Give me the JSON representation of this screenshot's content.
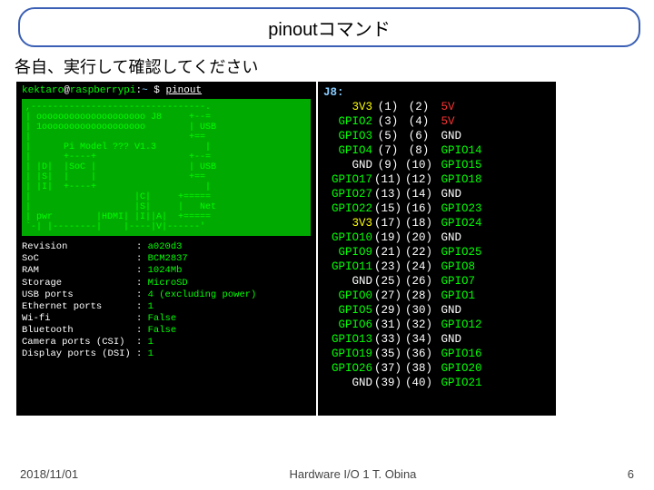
{
  "title": "pinoutコマンド",
  "subtitle": "各自、実行して確認してください",
  "prompt": {
    "user": "kektaro",
    "host": "raspberrypi",
    "path": "~",
    "cmd": "pinout"
  },
  "board_art": ",--------------------------------.\n| oooooooooooooooooooo J8     +--=\n| 1ooooooooooooooooooo        | USB\n|                             +==\n|      Pi Model ??? V1.3         |\n|      +----+                 +--=\n| |D|  |SoC |                 | USB\n| |S|  |    |                 +==\n| |I|  +----+                    |\n|                   |C|     +=====\n|                   |S|     |   Net\n| pwr        |HDMI| |I||A|  +=====\n`-| |--------|    |----|V|------'",
  "specs": [
    {
      "k": "Revision",
      "v": "a020d3"
    },
    {
      "k": "SoC",
      "v": "BCM2837"
    },
    {
      "k": "RAM",
      "v": "1024Mb"
    },
    {
      "k": "Storage",
      "v": "MicroSD"
    },
    {
      "k": "USB ports",
      "v": "4 (excluding power)"
    },
    {
      "k": "Ethernet ports",
      "v": "1"
    },
    {
      "k": "Wi-fi",
      "v": "False"
    },
    {
      "k": "Bluetooth",
      "v": "False"
    },
    {
      "k": "Camera ports (CSI)",
      "v": "1"
    },
    {
      "k": "Display ports (DSI)",
      "v": "1"
    }
  ],
  "j8_header": "J8:",
  "pins": [
    {
      "l": "3V3",
      "lcls": "c-yellow",
      "n1": "(1)",
      "n2": "(2)",
      "r": "5V",
      "rcls": "c-red"
    },
    {
      "l": "GPIO2",
      "lcls": "c-green",
      "n1": "(3)",
      "n2": "(4)",
      "r": "5V",
      "rcls": "c-red"
    },
    {
      "l": "GPIO3",
      "lcls": "c-green",
      "n1": "(5)",
      "n2": "(6)",
      "r": "GND",
      "rcls": "c-white"
    },
    {
      "l": "GPIO4",
      "lcls": "c-green",
      "n1": "(7)",
      "n2": "(8)",
      "r": "GPIO14",
      "rcls": "c-green"
    },
    {
      "l": "GND",
      "lcls": "c-white",
      "n1": "(9)",
      "n2": "(10)",
      "r": "GPIO15",
      "rcls": "c-green"
    },
    {
      "l": "GPIO17",
      "lcls": "c-green",
      "n1": "(11)",
      "n2": "(12)",
      "r": "GPIO18",
      "rcls": "c-green"
    },
    {
      "l": "GPIO27",
      "lcls": "c-green",
      "n1": "(13)",
      "n2": "(14)",
      "r": "GND",
      "rcls": "c-white"
    },
    {
      "l": "GPIO22",
      "lcls": "c-green",
      "n1": "(15)",
      "n2": "(16)",
      "r": "GPIO23",
      "rcls": "c-green"
    },
    {
      "l": "3V3",
      "lcls": "c-yellow",
      "n1": "(17)",
      "n2": "(18)",
      "r": "GPIO24",
      "rcls": "c-green"
    },
    {
      "l": "GPIO10",
      "lcls": "c-green",
      "n1": "(19)",
      "n2": "(20)",
      "r": "GND",
      "rcls": "c-white"
    },
    {
      "l": "GPIO9",
      "lcls": "c-green",
      "n1": "(21)",
      "n2": "(22)",
      "r": "GPIO25",
      "rcls": "c-green"
    },
    {
      "l": "GPIO11",
      "lcls": "c-green",
      "n1": "(23)",
      "n2": "(24)",
      "r": "GPIO8",
      "rcls": "c-green"
    },
    {
      "l": "GND",
      "lcls": "c-white",
      "n1": "(25)",
      "n2": "(26)",
      "r": "GPIO7",
      "rcls": "c-green"
    },
    {
      "l": "GPIO0",
      "lcls": "c-green",
      "n1": "(27)",
      "n2": "(28)",
      "r": "GPIO1",
      "rcls": "c-green"
    },
    {
      "l": "GPIO5",
      "lcls": "c-green",
      "n1": "(29)",
      "n2": "(30)",
      "r": "GND",
      "rcls": "c-white"
    },
    {
      "l": "GPIO6",
      "lcls": "c-green",
      "n1": "(31)",
      "n2": "(32)",
      "r": "GPIO12",
      "rcls": "c-green"
    },
    {
      "l": "GPIO13",
      "lcls": "c-green",
      "n1": "(33)",
      "n2": "(34)",
      "r": "GND",
      "rcls": "c-white"
    },
    {
      "l": "GPIO19",
      "lcls": "c-green",
      "n1": "(35)",
      "n2": "(36)",
      "r": "GPIO16",
      "rcls": "c-green"
    },
    {
      "l": "GPIO26",
      "lcls": "c-green",
      "n1": "(37)",
      "n2": "(38)",
      "r": "GPIO20",
      "rcls": "c-green"
    },
    {
      "l": "GND",
      "lcls": "c-white",
      "n1": "(39)",
      "n2": "(40)",
      "r": "GPIO21",
      "rcls": "c-green"
    }
  ],
  "footer": {
    "date": "2018/11/01",
    "center": "Hardware I/O 1 T. Obina",
    "page": "6"
  }
}
